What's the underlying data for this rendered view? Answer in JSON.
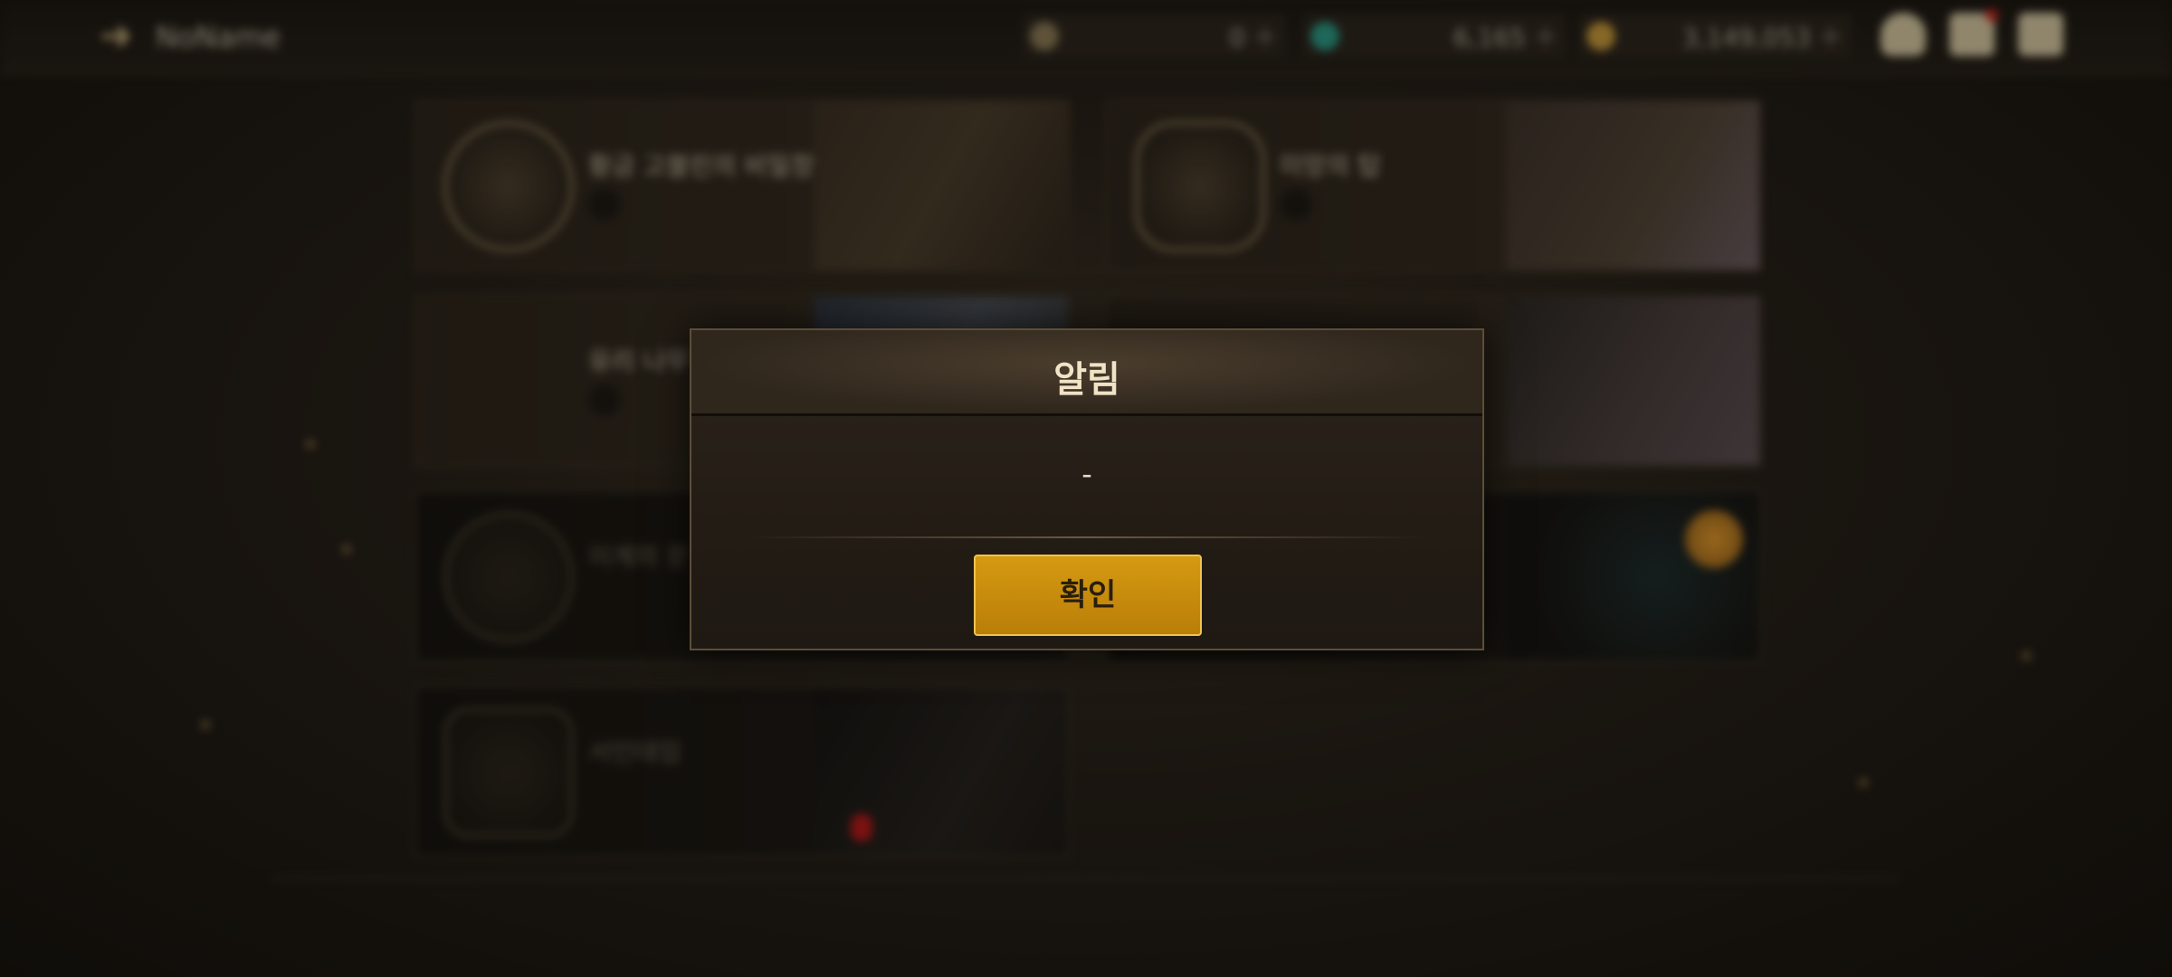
{
  "top_bar": {
    "player_name": "NoName",
    "currencies": [
      {
        "icon": "moon-token-icon",
        "value": "0"
      },
      {
        "icon": "crystal-icon",
        "value": "6,165"
      },
      {
        "icon": "gold-coin-icon",
        "value": "3,149,053"
      }
    ]
  },
  "cards": [
    {
      "title": "황금 고블린의 비밀창고"
    },
    {
      "title": "미망의 탑"
    },
    {
      "title": "유리 나무"
    },
    {
      "title": ""
    },
    {
      "title": "이계의 문"
    },
    {
      "title": ""
    },
    {
      "title": "서인데임"
    }
  ],
  "dialog": {
    "title": "알림",
    "message": "-",
    "confirm_label": "확인"
  },
  "colors": {
    "confirm_button": "#c98a0c",
    "dialog_title": "#f0e3c6",
    "mail_notification": "#d1261f"
  }
}
